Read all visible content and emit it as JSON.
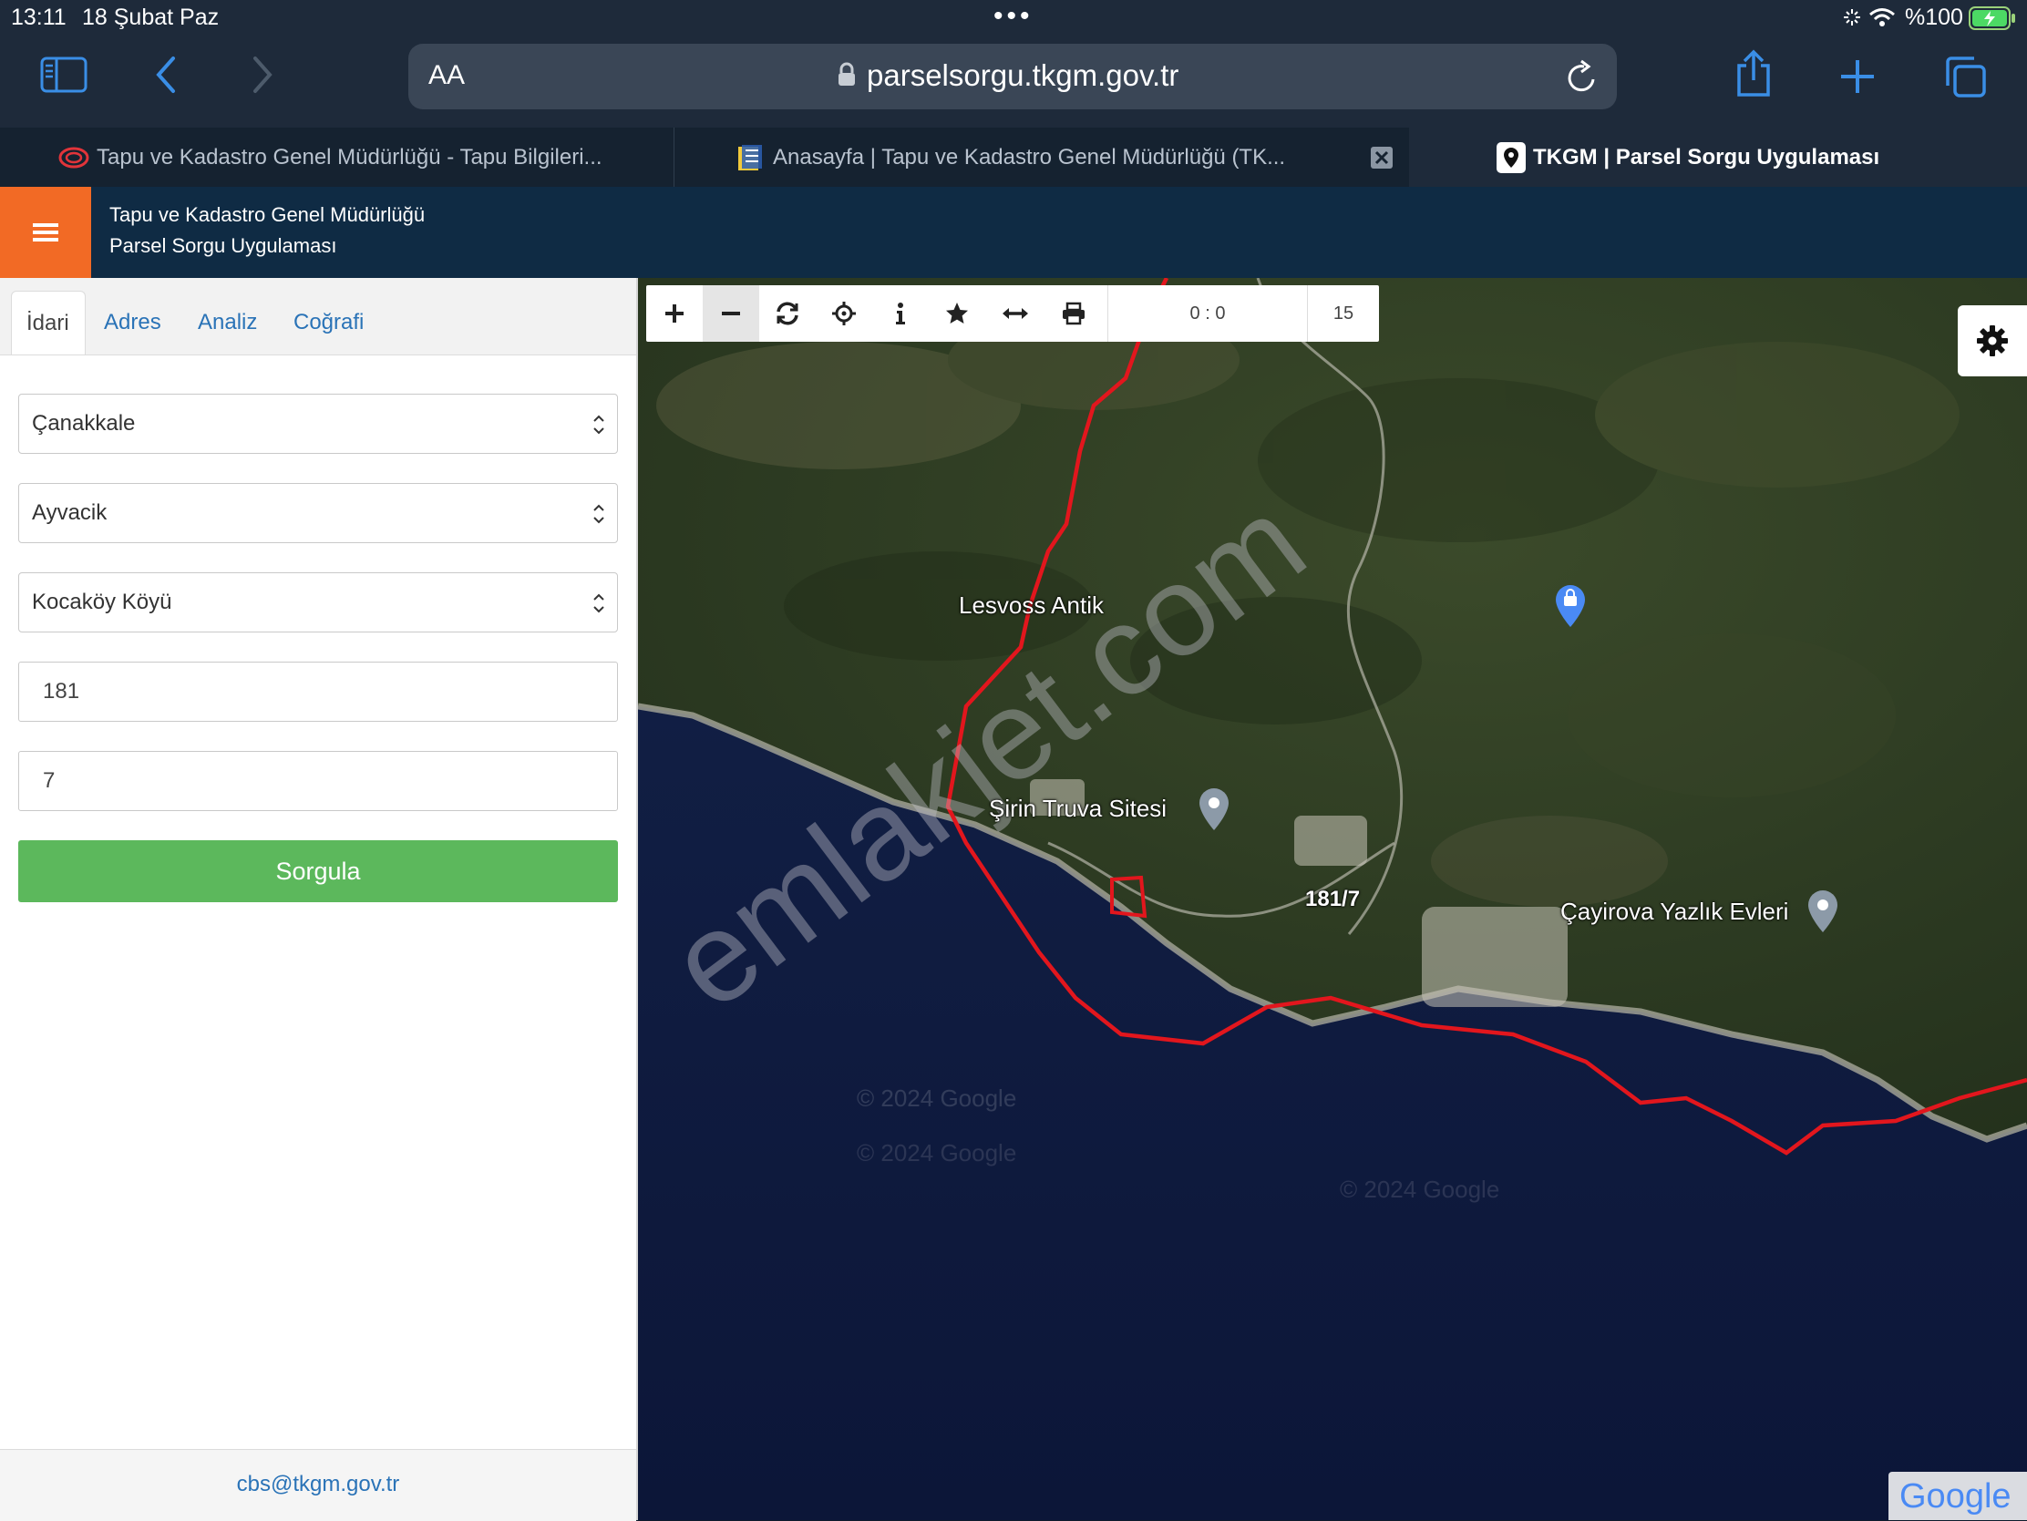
{
  "status_bar": {
    "time": "13:11",
    "date": "18 Şubat Paz",
    "battery": "%100"
  },
  "browser": {
    "text_size_label": "AA",
    "url": "parselsorgu.tkgm.gov.tr",
    "tabs": [
      {
        "title": "Tapu ve Kadastro Genel Müdürlüğü - Tapu Bilgileri..."
      },
      {
        "title": "Anasayfa | Tapu ve Kadastro Genel Müdürlüğü (TK..."
      },
      {
        "title": "TKGM | Parsel Sorgu Uygulaması"
      }
    ]
  },
  "app_header": {
    "line1": "Tapu ve Kadastro Genel Müdürlüğü",
    "line2": "Parsel Sorgu Uygulaması"
  },
  "nav_tabs": [
    "İdari",
    "Adres",
    "Analiz",
    "Coğrafi"
  ],
  "form": {
    "il": "Çanakkale",
    "ilce": "Ayvacik",
    "mahalle": "Kocaköy Köyü",
    "ada": "181",
    "parsel": "7",
    "submit_label": "Sorgula"
  },
  "footer": {
    "email": "cbs@tkgm.gov.tr"
  },
  "map": {
    "coords": "0 : 0",
    "zoom": "15",
    "places": [
      "Lesvoss Antik",
      "Şirin Truva Sitesi",
      "Çayirova Yazlık Evleri"
    ],
    "parcel_label": "181/7",
    "watermark": "emlakjet.com",
    "copyright": "© 2024 Google",
    "provider": "Google"
  },
  "colors": {
    "orange": "#f26a25",
    "navy": "#0f2b44",
    "green": "#5cb85c",
    "link": "#2a73b7",
    "boundary": "#e2161d"
  }
}
